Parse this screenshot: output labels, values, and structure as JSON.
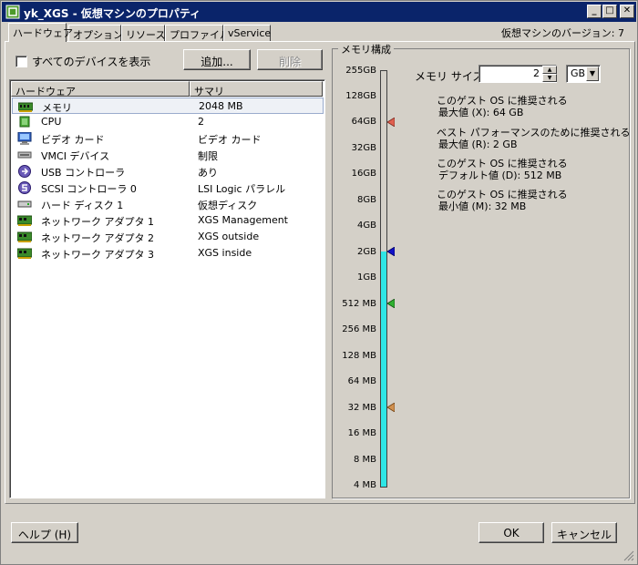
{
  "window": {
    "title": "yk_XGS - 仮想マシンのプロパティ",
    "min_glyph": "_",
    "max_glyph": "□",
    "close_glyph": "✕"
  },
  "tabs": [
    {
      "label": "ハードウェア",
      "active": true
    },
    {
      "label": "オプション",
      "active": false
    },
    {
      "label": "リソース",
      "active": false
    },
    {
      "label": "プロファイル",
      "active": false
    },
    {
      "label": "vService",
      "active": false
    }
  ],
  "version_label": "仮想マシンのバージョン: 7",
  "show_all_devices_label": "すべてのデバイスを表示",
  "add_button": "追加...",
  "remove_button": "削除",
  "hardware_list": {
    "columns": [
      "ハードウェア",
      "サマリ"
    ],
    "rows": [
      {
        "icon": "memory-icon",
        "name": "メモリ",
        "summary": "2048 MB",
        "selected": true
      },
      {
        "icon": "cpu-icon",
        "name": "CPU",
        "summary": "2",
        "selected": false
      },
      {
        "icon": "monitor-icon",
        "name": "ビデオ カード",
        "summary": "ビデオ カード",
        "selected": false
      },
      {
        "icon": "vmci-icon",
        "name": "VMCI デバイス",
        "summary": "制限",
        "selected": false
      },
      {
        "icon": "usb-icon",
        "name": "USB コントローラ",
        "summary": "あり",
        "selected": false
      },
      {
        "icon": "scsi-icon",
        "name": "SCSI コントローラ 0",
        "summary": "LSI Logic パラレル",
        "selected": false
      },
      {
        "icon": "disk-icon",
        "name": "ハード ディスク 1",
        "summary": "仮想ディスク",
        "selected": false
      },
      {
        "icon": "network-icon",
        "name": "ネットワーク アダプタ 1",
        "summary": "XGS Management",
        "selected": false
      },
      {
        "icon": "network-icon",
        "name": "ネットワーク アダプタ 2",
        "summary": "XGS outside",
        "selected": false
      },
      {
        "icon": "network-icon",
        "name": "ネットワーク アダプタ 3",
        "summary": "XGS inside",
        "selected": false
      }
    ]
  },
  "memory": {
    "group_title": "メモリ構成",
    "size_label": "メモリ サイズ:",
    "size_value": "2",
    "unit": "GB",
    "scale_labels": [
      "255GB",
      "128GB",
      "64GB",
      "32GB",
      "16GB",
      "8GB",
      "4GB",
      "2GB",
      "1GB",
      "512 MB",
      "256 MB",
      "128 MB",
      "64 MB",
      "32 MB",
      "16 MB",
      "8 MB",
      "4 MB"
    ],
    "current_level": "2GB",
    "legend": [
      {
        "color": "#e06050",
        "line1": "このゲスト OS に推奨される",
        "line2": "最大値 (X): 64 GB",
        "at": "64GB"
      },
      {
        "color": "#1010c8",
        "line1": "ベスト パフォーマンスのために推奨される",
        "line2": "最大値 (R): 2 GB",
        "at": "2GB"
      },
      {
        "color": "#30b030",
        "line1": "このゲスト OS に推奨される",
        "line2": "デフォルト値 (D): 512 MB",
        "at": "512 MB"
      },
      {
        "color": "#d09050",
        "line1": "このゲスト OS に推奨される",
        "line2": "最小値 (M): 32 MB",
        "at": "32 MB"
      }
    ]
  },
  "help_button": "ヘルプ (H)",
  "ok_button": "OK",
  "cancel_button": "キャンセル"
}
